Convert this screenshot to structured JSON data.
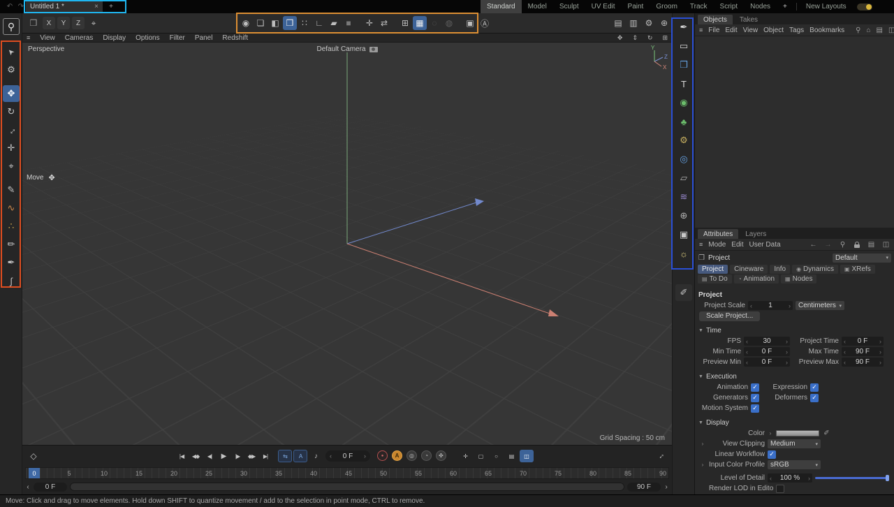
{
  "colors": {
    "accent_blue": "#3d6398",
    "annotation_cyan": "#1fb6f0",
    "annotation_orange": "#dd8f33",
    "annotation_red": "#dd4d20",
    "annotation_blue": "#2a4fd6",
    "autokey_orange": "#c8862e",
    "record_red": "#b45050",
    "axis_x_red": "#cc8072",
    "axis_y_green": "#79a879",
    "axis_z_blue": "#7289cc",
    "check_blue": "#3a6fc8"
  },
  "icons": {
    "hamburger": "≡",
    "search": "⚲",
    "close": "×",
    "add": "+",
    "undo": "↶",
    "redo": "↷",
    "undo_box": "❒",
    "coord_system": "⌖",
    "spinner_left": "‹",
    "spinner_right": "›",
    "dropdown_arrow": "▾",
    "section_arrow": "▼",
    "flyout": "›",
    "back": "←",
    "forward": "→",
    "home": "⌂",
    "panel_single": "▤",
    "panel_dual": "◫",
    "eyedropper": "✐",
    "check": "✓",
    "cube_small": "❒",
    "key_diamond": "◇",
    "go_start": "|◀",
    "prev_key": "◀◆",
    "prev_frame": "◀|",
    "play": "▶",
    "next_frame": "|▶",
    "next_key": "◆▶",
    "go_end": "▶|",
    "loop": "⇆",
    "all_frames": "A",
    "sound": "♪",
    "record": "●",
    "autokey": "A",
    "keyframe_sel": "◎",
    "key_time": "◔",
    "key_magnet": "✜",
    "pos_toggle": "✛",
    "scale_toggle": "▢",
    "rot_toggle": "○",
    "pla_toggle": "▤",
    "mini_timeline": "◫",
    "expand_timeline": "↔",
    "hand": "✥",
    "dolly": "⇕",
    "orbit": "↻",
    "view_layout": "⊞",
    "move_cursor": "✥",
    "render_view": "▤",
    "render_pv": "▥",
    "render_settings": "⚙",
    "sim_globe": "⊕",
    "dynamics_tab": "◉",
    "xrefs_tab": "▣",
    "todo_tab": "▤",
    "animation_tab": "◔",
    "nodes_tab": "▦"
  },
  "titlebar": {
    "doc_tab": "Untitled 1 *",
    "layout_tabs": [
      "Standard",
      "Model",
      "Sculpt",
      "UV Edit",
      "Paint",
      "Groom",
      "Track",
      "Script",
      "Nodes"
    ],
    "new_layouts": "New Layouts"
  },
  "toolbar": {
    "axis": [
      "X",
      "Y",
      "Z"
    ]
  },
  "top_tools": {
    "items": [
      {
        "name": "make-editable",
        "glyph": "◉"
      },
      {
        "name": "model-mode",
        "glyph": "❏"
      },
      {
        "name": "texture-mode",
        "glyph": "◧"
      },
      {
        "name": "object-mode",
        "glyph": "❒"
      },
      {
        "name": "points-mode",
        "glyph": "∷"
      },
      {
        "name": "edges-mode",
        "glyph": "∟"
      },
      {
        "name": "polygons-mode",
        "glyph": "▰"
      },
      {
        "name": "uv-mode",
        "glyph": "■"
      },
      {
        "name": "enable-axis",
        "glyph": "✛"
      },
      {
        "name": "axis-swap",
        "glyph": "⇄"
      },
      {
        "name": "workplane",
        "glyph": "⊞"
      },
      {
        "name": "snap-grid",
        "glyph": "▦"
      },
      {
        "name": "snap-off-1",
        "glyph": "◌"
      },
      {
        "name": "snap-off-2",
        "glyph": "◍"
      },
      {
        "name": "workplane-lock",
        "glyph": "▣"
      },
      {
        "name": "snap-mode",
        "glyph": "Ⓐ"
      }
    ]
  },
  "left_toolbar": {
    "items": [
      {
        "name": "live-selection",
        "glyph": "➤"
      },
      {
        "name": "tweak",
        "glyph": "⚙"
      },
      {
        "name": "move",
        "glyph": "✥"
      },
      {
        "name": "rotate",
        "glyph": "↻"
      },
      {
        "name": "scale",
        "glyph": "↔"
      },
      {
        "name": "free-move",
        "glyph": "✛"
      },
      {
        "name": "axis-modification",
        "glyph": "⌖"
      },
      {
        "name": "brush",
        "glyph": "✎"
      },
      {
        "name": "smear",
        "glyph": "∿"
      },
      {
        "name": "paint-colors",
        "glyph": "∴"
      },
      {
        "name": "pencil",
        "glyph": "✏"
      },
      {
        "name": "pen",
        "glyph": "✒"
      },
      {
        "name": "spline-smooth",
        "glyph": "∫"
      }
    ]
  },
  "right_strip": {
    "items": [
      {
        "name": "pen-tool",
        "glyph": "✒",
        "color": "#d8d8d8"
      },
      {
        "name": "spline-primitives",
        "glyph": "▭",
        "color": "#d8d8d8"
      },
      {
        "name": "primitive-objects",
        "glyph": "❒",
        "color": "#64a0e0"
      },
      {
        "name": "text-tool",
        "glyph": "T",
        "color": "#d8d8d8"
      },
      {
        "name": "generators",
        "glyph": "◉",
        "color": "#6cbe6c"
      },
      {
        "name": "mograph",
        "glyph": "♣",
        "color": "#6cbe6c"
      },
      {
        "name": "simulation",
        "glyph": "⚙",
        "color": "#c8b060"
      },
      {
        "name": "volumes",
        "glyph": "◎",
        "color": "#64a0e0"
      },
      {
        "name": "environment",
        "glyph": "▱",
        "color": "#b0b0b0"
      },
      {
        "name": "fields",
        "glyph": "≋",
        "color": "#9a8ad0"
      },
      {
        "name": "sky",
        "glyph": "⊕",
        "color": "#b0b0b0"
      },
      {
        "name": "camera",
        "glyph": "▣",
        "color": "#c8c8c8"
      },
      {
        "name": "light",
        "glyph": "☼",
        "color": "#e0d080"
      }
    ]
  },
  "viewport": {
    "menus": [
      "View",
      "Cameras",
      "Display",
      "Options",
      "Filter",
      "Panel",
      "Redshift"
    ],
    "label": "Perspective",
    "camera": "Default Camera",
    "tool_hint": "Move",
    "grid_spacing": "Grid Spacing : 50 cm",
    "gizmo": {
      "x": "X",
      "y": "Y",
      "z": "Z"
    }
  },
  "objects_panel": {
    "tabs": [
      "Objects",
      "Takes"
    ],
    "menus": [
      "File",
      "Edit",
      "View",
      "Object",
      "Tags",
      "Bookmarks"
    ]
  },
  "attributes": {
    "tabs": [
      "Attributes",
      "Layers"
    ],
    "menus": [
      "Mode",
      "Edit",
      "User Data"
    ],
    "object_name": "Project",
    "preset": "Default",
    "tab_row1": [
      "Project",
      "Cineware",
      "Info",
      "Dynamics",
      "XRefs"
    ],
    "tab_row2": [
      "To Do",
      "Animation",
      "Nodes"
    ],
    "header": "Project",
    "project_scale": {
      "label": "Project Scale",
      "value": "1",
      "unit": "Centimeters"
    },
    "scale_button": "Scale Project...",
    "time": {
      "title": "Time",
      "rows": [
        {
          "l1": "FPS",
          "v1": "30",
          "l2": "Project Time",
          "v2": "0 F"
        },
        {
          "l1": "Min Time",
          "v1": "0 F",
          "l2": "Max Time",
          "v2": "90 F"
        },
        {
          "l1": "Preview Min",
          "v1": "0 F",
          "l2": "Preview Max",
          "v2": "90 F"
        }
      ]
    },
    "execution": {
      "title": "Execution",
      "rows": [
        {
          "l1": "Animation",
          "c1": true,
          "l2": "Expression",
          "c2": true
        },
        {
          "l1": "Generators",
          "c1": true,
          "l2": "Deformers",
          "c2": true
        },
        {
          "l1": "Motion System",
          "c1": true
        }
      ]
    },
    "display": {
      "title": "Display",
      "color_label": "Color",
      "view_clipping": "View Clipping",
      "view_clipping_value": "Medium",
      "linear_workflow": "Linear Workflow",
      "input_profile": "Input Color Profile",
      "input_profile_value": "sRGB"
    },
    "lod": {
      "label": "Level of Detail",
      "value": "100 %"
    },
    "render_lod": "Render LOD in Editor"
  },
  "timeline": {
    "ticks": [
      "0",
      "5",
      "10",
      "15",
      "20",
      "25",
      "30",
      "35",
      "40",
      "45",
      "50",
      "55",
      "60",
      "65",
      "70",
      "75",
      "80",
      "85",
      "90"
    ],
    "playhead": "0",
    "frame": "0 F",
    "range_start": "0 F",
    "range_end": "90 F"
  },
  "statusbar": {
    "text": "Move: Click and drag to move elements. Hold down SHIFT to quantize movement / add to the selection in point mode, CTRL to remove."
  }
}
